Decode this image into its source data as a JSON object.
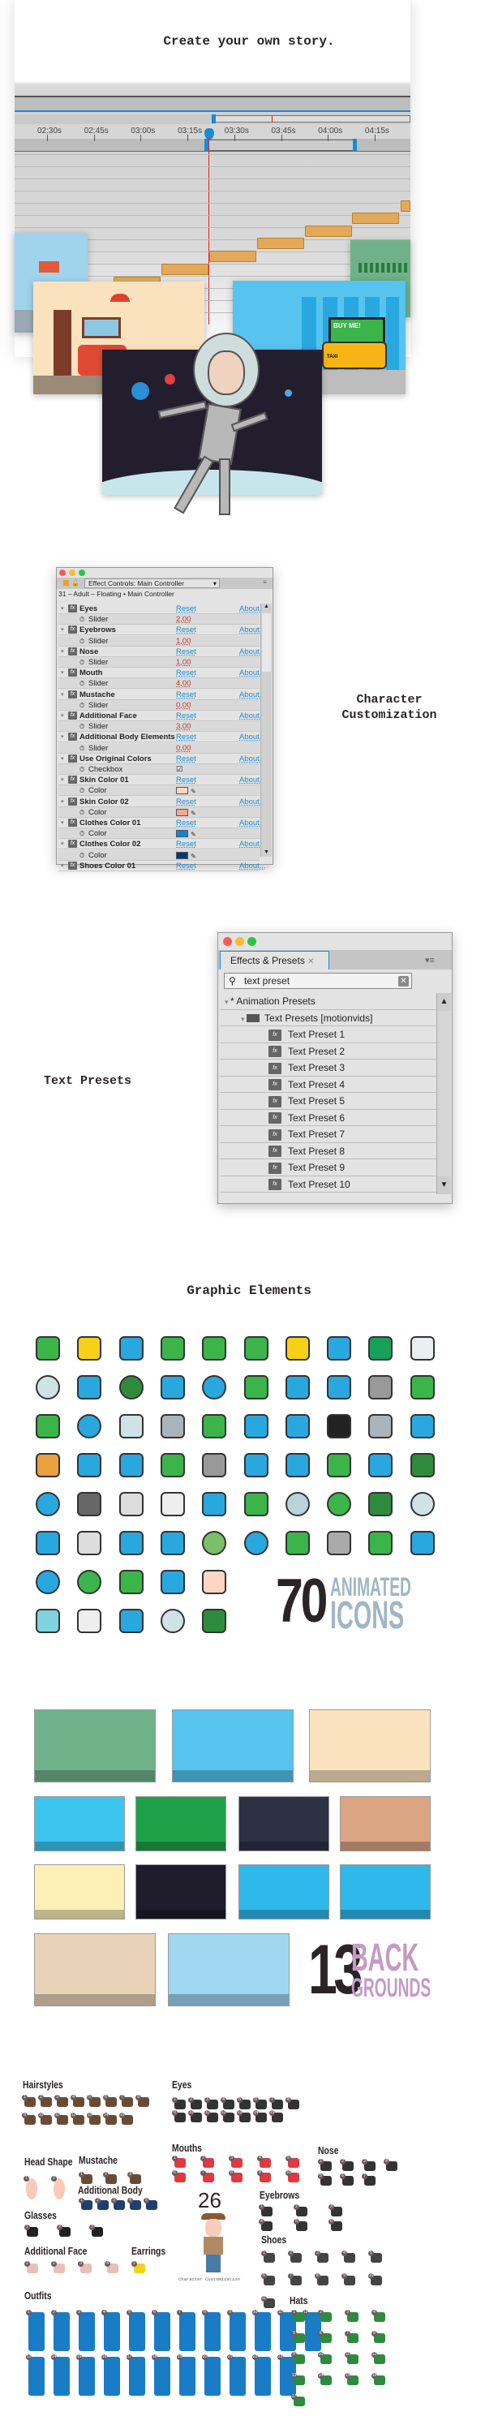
{
  "hero": {
    "title": "Create your own story.",
    "timeline_labels": [
      "02:30s",
      "02:45s",
      "03:00s",
      "03:15s",
      "03:30s",
      "03:45s",
      "04:00s",
      "04:15s"
    ],
    "billboard_text": "BUY ME!",
    "taxi_text": "TAXI",
    "playhead_color": "#e02020",
    "accent": "#1a8ad4"
  },
  "effect_controls": {
    "tab_title": "Effect Controls: Main Controller",
    "layer_path": "31 – Adult – Floating • Main Controller",
    "reset_label": "Reset",
    "about_label": "About...",
    "rows": [
      {
        "name": "Eyes",
        "param": "Slider",
        "value": "2,00"
      },
      {
        "name": "Eyebrows",
        "param": "Slider",
        "value": "1,00"
      },
      {
        "name": "Nose",
        "param": "Slider",
        "value": "1,00"
      },
      {
        "name": "Mouth",
        "param": "Slider",
        "value": "4,00"
      },
      {
        "name": "Mustache",
        "param": "Slider",
        "value": "0,00"
      },
      {
        "name": "Additional Face",
        "param": "Slider",
        "value": "3,00"
      },
      {
        "name": "Additional Body Elements",
        "param": "Slider",
        "value": "0,00"
      },
      {
        "name": "Use Original Colors",
        "param": "Checkbox",
        "value": "☑"
      },
      {
        "name": "Skin Color 01",
        "param": "Color",
        "color": "#fdd5c4"
      },
      {
        "name": "Skin Color 02",
        "param": "Color",
        "color": "#f0a890"
      },
      {
        "name": "Clothes Color 01",
        "param": "Color",
        "color": "#0a86cc"
      },
      {
        "name": "Clothes Color 02",
        "param": "Color",
        "color": "#003a78"
      },
      {
        "name": "Shoes Color 01",
        "param": "",
        "value": ""
      }
    ]
  },
  "character_customization_label": "Character Customization",
  "text_presets_label": "Text Presets",
  "effects_presets": {
    "tab_title": "Effects & Presets",
    "search_value": "text preset",
    "group": "* Animation Presets",
    "folder": "Text Presets [motionvids]",
    "items": [
      "Text Preset 1",
      "Text Preset 2",
      "Text Preset 3",
      "Text Preset 4",
      "Text Preset 5",
      "Text Preset 6",
      "Text Preset 7",
      "Text Preset 8",
      "Text Preset 9",
      "Text Preset 10"
    ]
  },
  "graphic_elements": {
    "heading": "Graphic Elements",
    "icons_count": "70",
    "icons_word1": "ANIMATED",
    "icons_word2": "ICONS",
    "icons": [
      {
        "n": "trophy",
        "c": "#3bb54a"
      },
      {
        "n": "lightbulb",
        "c": "#f7d117"
      },
      {
        "n": "gift",
        "c": "#29a8e0"
      },
      {
        "n": "tools",
        "c": "#3bb54a"
      },
      {
        "n": "backpack",
        "c": "#3bb54a"
      },
      {
        "n": "shopping-bag",
        "c": "#3bb54a"
      },
      {
        "n": "beer-mug",
        "c": "#f7d117"
      },
      {
        "n": "key",
        "c": "#29a8e0"
      },
      {
        "n": "heart",
        "c": "#17a05a"
      },
      {
        "n": "envelope",
        "c": "#e8f0f0"
      },
      {
        "n": "baseball",
        "c": "#cfe3e6"
      },
      {
        "n": "book",
        "c": "#29a8e0"
      },
      {
        "n": "basketball",
        "c": "#2e8b3e"
      },
      {
        "n": "calculator",
        "c": "#29a8e0"
      },
      {
        "n": "clock",
        "c": "#29a8e0"
      },
      {
        "n": "guitar",
        "c": "#3bb54a"
      },
      {
        "n": "monitor",
        "c": "#29a8e0"
      },
      {
        "n": "magnifier",
        "c": "#29a8e0"
      },
      {
        "n": "microphone",
        "c": "#999"
      },
      {
        "n": "pointing-hand",
        "c": "#3bb54a"
      },
      {
        "n": "box",
        "c": "#3bb54a"
      },
      {
        "n": "pie-chart",
        "c": "#29a8e0"
      },
      {
        "n": "coffee-cup",
        "c": "#cfe3e6"
      },
      {
        "n": "cloud",
        "c": "#aab4bb"
      },
      {
        "n": "glasses",
        "c": "#3bb54a"
      },
      {
        "n": "hourglass",
        "c": "#29a8e0"
      },
      {
        "n": "presentation",
        "c": "#29a8e0"
      },
      {
        "n": "piano",
        "c": "#222"
      },
      {
        "n": "rain-cloud",
        "c": "#aab4bb"
      },
      {
        "n": "shirt",
        "c": "#29a8e0"
      },
      {
        "n": "burger",
        "c": "#e8a040"
      },
      {
        "n": "cloud-upload",
        "c": "#29a8e0"
      },
      {
        "n": "drum",
        "c": "#29a8e0"
      },
      {
        "n": "thumbs-up",
        "c": "#3bb54a"
      },
      {
        "n": "cutlery",
        "c": "#999"
      },
      {
        "n": "cocktail",
        "c": "#29a8e0"
      },
      {
        "n": "music-notes",
        "c": "#29a8e0"
      },
      {
        "n": "piggy-bank",
        "c": "#3bb54a"
      },
      {
        "n": "waves",
        "c": "#29a8e0"
      },
      {
        "n": "basket",
        "c": "#2e8b3e"
      },
      {
        "n": "globe",
        "c": "#29a8e0"
      },
      {
        "n": "dumbbell",
        "c": "#666"
      },
      {
        "n": "gears",
        "c": "#ddd"
      },
      {
        "n": "mouse",
        "c": "#eee"
      },
      {
        "n": "beaker",
        "c": "#29a8e0"
      },
      {
        "n": "money",
        "c": "#3bb54a"
      },
      {
        "n": "moon",
        "c": "#b8d4d8"
      },
      {
        "n": "sun",
        "c": "#3bb54a"
      },
      {
        "n": "sweater",
        "c": "#2e8b3e"
      },
      {
        "n": "soccer-ball",
        "c": "#cfe3e6"
      },
      {
        "n": "padlock",
        "c": "#29a8e0"
      },
      {
        "n": "newspaper",
        "c": "#ddd"
      },
      {
        "n": "pencil",
        "c": "#29a8e0"
      },
      {
        "n": "smartphone",
        "c": "#29a8e0"
      },
      {
        "n": "planet",
        "c": "#7cbf6a"
      },
      {
        "n": "football",
        "c": "#29a8e0"
      },
      {
        "n": "ribbon",
        "c": "#3bb54a"
      },
      {
        "n": "skull",
        "c": "#aaa"
      },
      {
        "n": "credit-card",
        "c": "#3bb54a"
      },
      {
        "n": "tablet",
        "c": "#29a8e0"
      },
      {
        "n": "target",
        "c": "#29a8e0"
      },
      {
        "n": "stopwatch",
        "c": "#3bb54a"
      },
      {
        "n": "tree",
        "c": "#3bb54a"
      },
      {
        "n": "tv",
        "c": "#29a8e0"
      },
      {
        "n": "support-agent",
        "c": "#fdd5c4"
      },
      {
        "n": "water-glass",
        "c": "#7fd3e0"
      },
      {
        "n": "clipboard",
        "c": "#eee"
      },
      {
        "n": "user",
        "c": "#29a8e0"
      },
      {
        "n": "volleyball",
        "c": "#cfe3e6"
      },
      {
        "n": "briefcase",
        "c": "#2e8b3e"
      }
    ]
  },
  "backgrounds": {
    "count": "13",
    "word1": "BACK",
    "word2": "GROUNDS",
    "items": [
      {
        "n": "shop",
        "c": "#6fb28a"
      },
      {
        "n": "city-street",
        "c": "#56c4ef"
      },
      {
        "n": "living-room",
        "c": "#fbe2be"
      },
      {
        "n": "beach",
        "c": "#3cc6ef"
      },
      {
        "n": "boutique",
        "c": "#1fa14a"
      },
      {
        "n": "halloween-night",
        "c": "#2e3145"
      },
      {
        "n": "christmas-room",
        "c": "#dba483"
      },
      {
        "n": "bank-vault",
        "c": "#fdf0b6"
      },
      {
        "n": "space",
        "c": "#1f1d2c"
      },
      {
        "n": "mountains",
        "c": "#2fb8ea"
      },
      {
        "n": "bus-stop",
        "c": "#2fb8ea"
      },
      {
        "n": "office",
        "c": "#e9d3b8"
      },
      {
        "n": "laboratory",
        "c": "#9fd7f0"
      }
    ]
  },
  "character_sheet": {
    "count": "26",
    "caption": "Character Customization",
    "sections": [
      {
        "title": "Hairstyles",
        "count": 15,
        "color": "#6b4a35"
      },
      {
        "title": "Eyes",
        "count": 15,
        "color": "#333"
      },
      {
        "title": "Mouths",
        "count": 10,
        "color": "#e0393e"
      },
      {
        "title": "Nose",
        "count": 7,
        "color": "#333"
      },
      {
        "title": "Head Shape",
        "count": 2,
        "color": "#fbcab6"
      },
      {
        "title": "Mustache",
        "count": 3,
        "color": "#6b4a35"
      },
      {
        "title": "Additional Body",
        "count": 5,
        "color": "#1f3f70"
      },
      {
        "title": "Glasses",
        "count": 3,
        "color": "#222"
      },
      {
        "title": "Eyebrows",
        "count": 6,
        "color": "#333"
      },
      {
        "title": "Shoes",
        "count": 11,
        "color": "#444"
      },
      {
        "title": "Additional Face",
        "count": 4,
        "color": "#e8c0b8"
      },
      {
        "title": "Earrings",
        "count": 1,
        "color": "#f7d117"
      },
      {
        "title": "Outfits",
        "count": 23,
        "color": "#1a7cc4"
      },
      {
        "title": "Hats",
        "count": 17,
        "color": "#2e8b3e"
      }
    ]
  }
}
